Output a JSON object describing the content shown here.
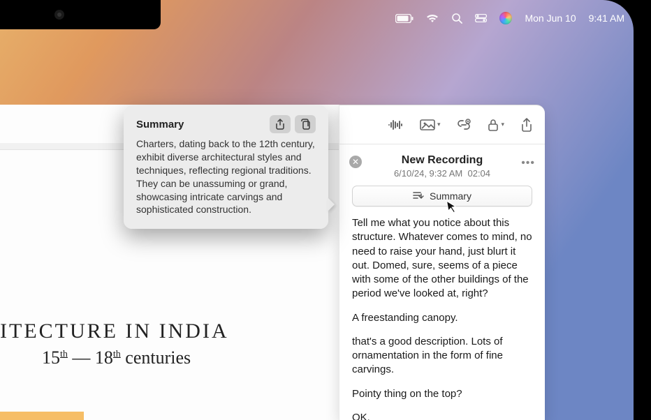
{
  "menubar": {
    "date": "Mon Jun 10",
    "time": "9:41 AM"
  },
  "popover": {
    "title": "Summary",
    "text": "Charters, dating back to the 12th century, exhibit diverse architectural styles and techniques, reflecting regional traditions. They can be unassuming or grand, showcasing intricate carvings and sophisticated construction."
  },
  "handwriting": {
    "line1": "ITECTURE IN INDIA",
    "line2_prefix": "15",
    "line2_sup1": "th",
    "line2_mid": " — 18",
    "line2_sup2": "th",
    "line2_suffix": " centuries"
  },
  "recording": {
    "title": "New Recording",
    "date": "6/10/24, 9:32 AM",
    "duration": "02:04",
    "summary_button": "Summary"
  },
  "transcript": {
    "p1": "Tell me what you notice about this structure. Whatever comes to mind, no need to raise your hand, just blurt it out. Domed, sure, seems of a piece with some of the other buildings of the period we've looked at, right?",
    "p2": "A freestanding canopy.",
    "p3": "that's a good description. Lots of ornamentation in the form of fine carvings.",
    "p4": "Pointy thing on the top?",
    "p5": "OK."
  }
}
